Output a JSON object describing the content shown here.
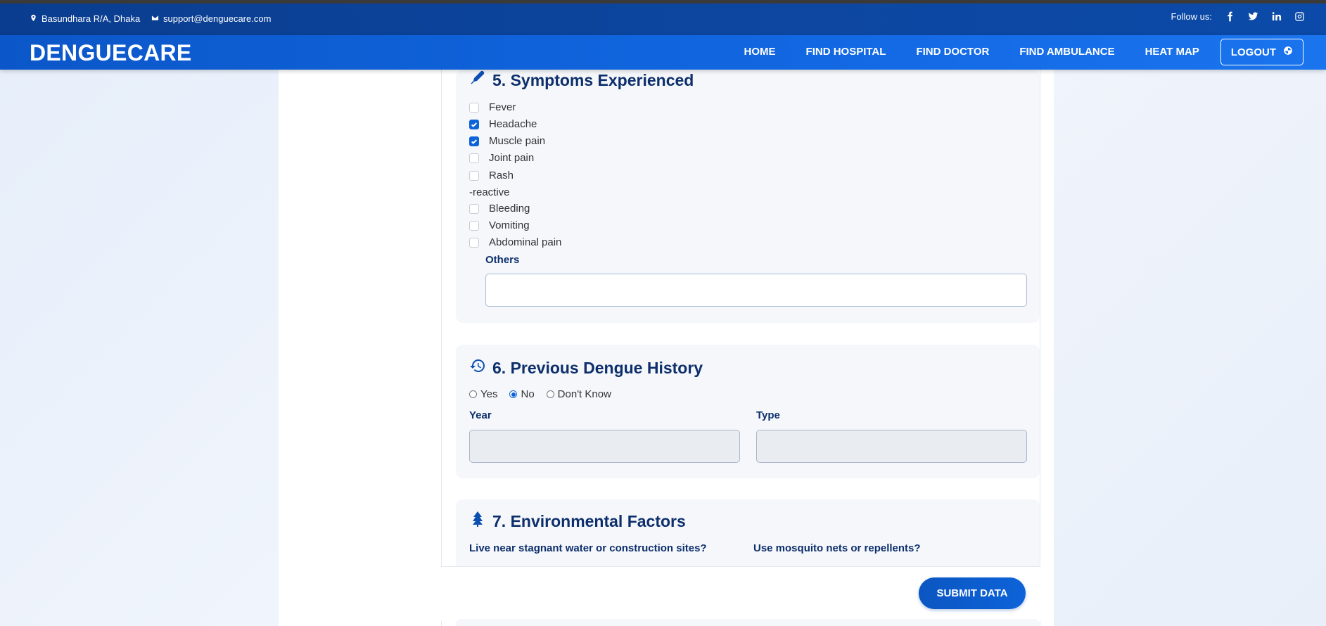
{
  "topbar": {
    "address": "Basundhara R/A, Dhaka",
    "email": "support@denguecare.com",
    "follow_label": "Follow us:",
    "social_icons": [
      "facebook-icon",
      "twitter-icon",
      "linkedin-icon",
      "instagram-icon"
    ]
  },
  "navbar": {
    "brand": "DENGUECARE",
    "links": [
      "HOME",
      "FIND HOSPITAL",
      "FIND DOCTOR",
      "FIND AMBULANCE",
      "HEAT MAP"
    ],
    "logout": "LOGOUT"
  },
  "symptoms": {
    "title": "5. Symptoms Experienced",
    "icon": "thermometer-icon",
    "items": [
      {
        "label": "Fever",
        "checked": false
      },
      {
        "label": "Headache",
        "checked": true
      },
      {
        "label": "Muscle pain",
        "checked": true
      },
      {
        "label": "Joint pain",
        "checked": false
      },
      {
        "label": "Rash",
        "checked": false
      },
      {
        "label": "Bleeding",
        "checked": false
      },
      {
        "label": "Vomiting",
        "checked": false
      },
      {
        "label": "Abdominal pain",
        "checked": false
      }
    ],
    "stray_text": "-reactive",
    "others_label": "Others",
    "others_value": ""
  },
  "history": {
    "title": "6. Previous Dengue History",
    "icon": "history-icon",
    "options": [
      "Yes",
      "No",
      "Don't Know"
    ],
    "selected": "No",
    "year_label": "Year",
    "type_label": "Type"
  },
  "environment": {
    "title": "7. Environmental Factors",
    "icon": "tree-icon",
    "q1": "Live near stagnant water or construction sites?",
    "q2": "Use mosquito nets or repellents?"
  },
  "footer": {
    "submit": "SUBMIT DATA"
  },
  "colors": {
    "primary": "#0d63d8",
    "dark_navy": "#0d2f6b",
    "topbar": "#0d47a1"
  }
}
